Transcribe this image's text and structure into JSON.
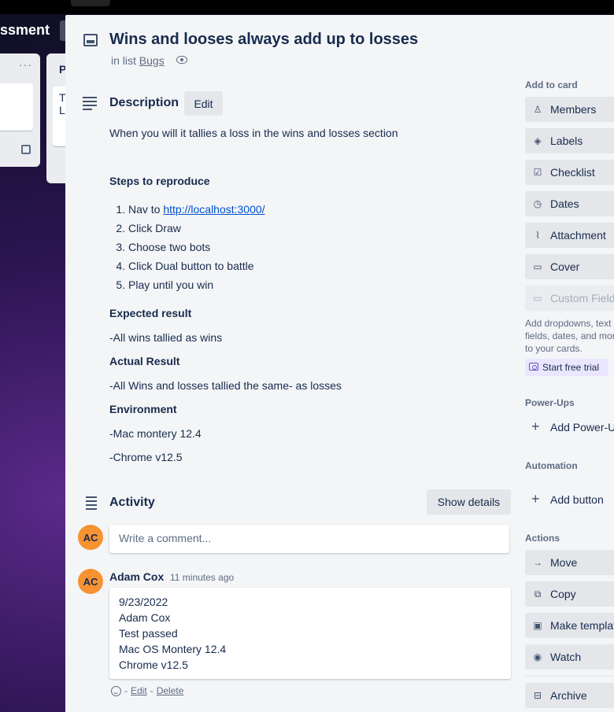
{
  "board": {
    "title": "ssment",
    "list2_title": "P",
    "list2_card_text": "T\nL"
  },
  "card": {
    "title": "Wins and looses always add up to losses",
    "in_list_prefix": "in list",
    "list_name": "Bugs"
  },
  "description": {
    "heading": "Description",
    "edit_label": "Edit",
    "summary": "When you will it tallies a loss in the wins and losses section",
    "steps_heading": "Steps to reproduce",
    "steps": [
      {
        "prefix": "Nav to ",
        "link": "http://localhost:3000/"
      },
      {
        "text": "Click Draw"
      },
      {
        "text": "Choose two bots"
      },
      {
        "text": "Click Dual button to battle"
      },
      {
        "text": "Play until you win"
      }
    ],
    "expected_heading": "Expected result",
    "expected": "-All wins tallied as wins",
    "actual_heading": "Actual Result",
    "actual": "-All Wins and losses tallied the same- as losses",
    "env_heading": "Environment",
    "env_os": "-Mac montery 12.4",
    "env_browser": "-Chrome v12.5"
  },
  "activity": {
    "heading": "Activity",
    "show_details_label": "Show details",
    "comment_placeholder": "Write a comment...",
    "avatar_initials": "AC",
    "comment": {
      "author": "Adam Cox",
      "time": "11 minutes ago",
      "lines": [
        "9/23/2022",
        "Adam Cox",
        "Test passed",
        "Mac OS Montery 12.4",
        "Chrome v12.5"
      ],
      "separator": "-",
      "edit_label": "Edit",
      "delete_label": "Delete"
    }
  },
  "sidebar": {
    "add_to_card_heading": "Add to card",
    "add_to_card": [
      {
        "label": "Members",
        "icon": "person-icon"
      },
      {
        "label": "Labels",
        "icon": "tag-icon"
      },
      {
        "label": "Checklist",
        "icon": "checklist-icon"
      },
      {
        "label": "Dates",
        "icon": "clock-icon"
      },
      {
        "label": "Attachment",
        "icon": "paperclip-icon"
      },
      {
        "label": "Cover",
        "icon": "cover-icon"
      },
      {
        "label": "Custom Fields",
        "icon": "custom-fields-icon"
      }
    ],
    "custom_fields_note": "Add dropdowns, text fields, dates, and more to your cards.",
    "trial_label": "Start free trial",
    "powerups_heading": "Power-Ups",
    "add_powerups_label": "Add Power-Ups",
    "automation_heading": "Automation",
    "add_button_label": "Add button",
    "actions_heading": "Actions",
    "actions": [
      {
        "label": "Move",
        "icon": "arrow-right-icon"
      },
      {
        "label": "Copy",
        "icon": "copy-icon"
      },
      {
        "label": "Make template",
        "icon": "template-icon"
      },
      {
        "label": "Watch",
        "icon": "eye-icon"
      },
      {
        "label": "Archive",
        "icon": "archive-icon"
      }
    ]
  },
  "colors": {
    "avatar": "#f79233",
    "link": "#0052cc",
    "modal_bg": "#f4f5f7",
    "button_bg": "#e4e6ea",
    "trial_bg": "#eae6ff"
  }
}
